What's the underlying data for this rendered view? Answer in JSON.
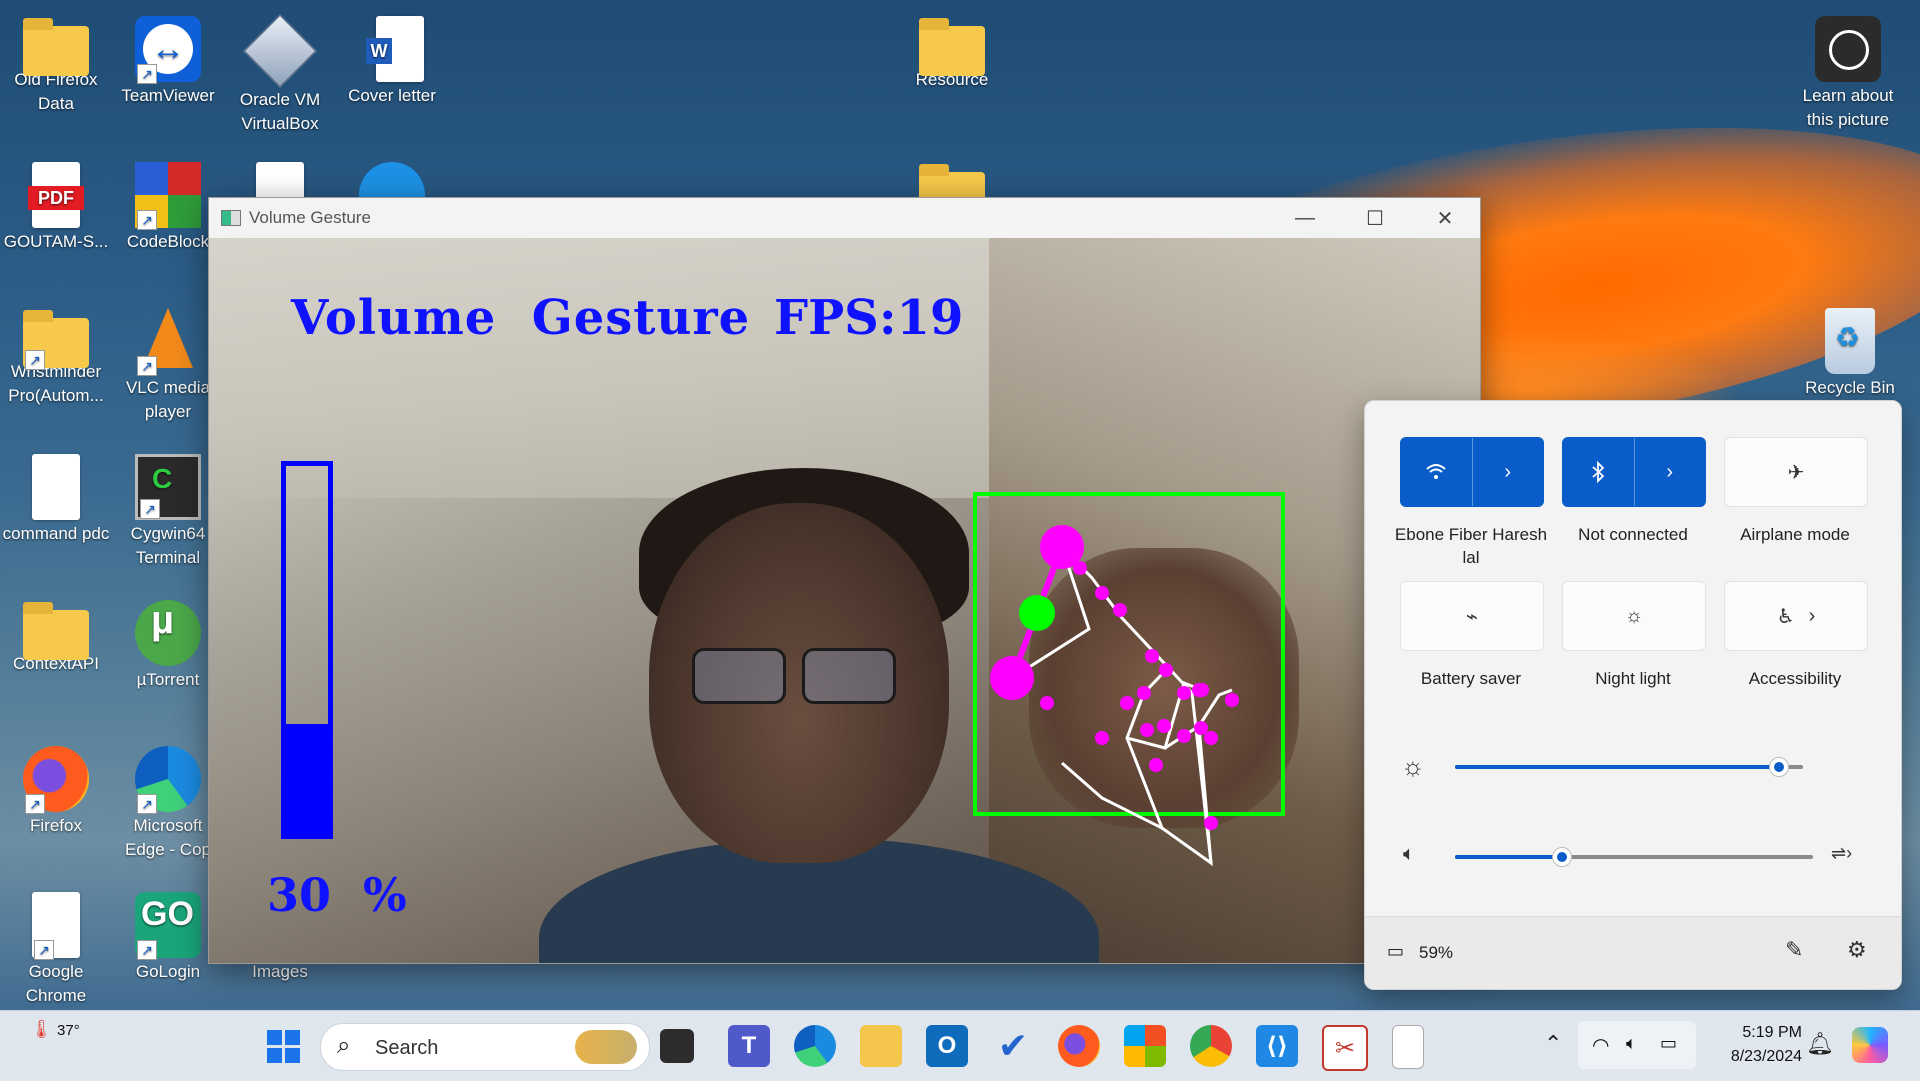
{
  "desktop": {
    "icons": [
      {
        "label": "Old Firefox Data"
      },
      {
        "label": "TeamViewer"
      },
      {
        "label": "Oracle VM VirtualBox"
      },
      {
        "label": "Cover letter"
      },
      {
        "label": "Resource"
      },
      {
        "label": "Learn about this picture"
      },
      {
        "label": "GOUTAM-S..."
      },
      {
        "label": "CodeBlock"
      },
      {
        "label": "Wristminder Pro(Autom..."
      },
      {
        "label": "VLC media player"
      },
      {
        "label": "Recycle Bin"
      },
      {
        "label": "command pdc"
      },
      {
        "label": "Cygwin64 Terminal"
      },
      {
        "label": "ContextAPI"
      },
      {
        "label": "µTorrent"
      },
      {
        "label": "Firefox"
      },
      {
        "label": "Microsoft Edge - Cop"
      },
      {
        "label": "Google Chrome"
      },
      {
        "label": "GoLogin"
      },
      {
        "label": "Images"
      }
    ]
  },
  "window": {
    "title": "Volume Gesture",
    "overlay": {
      "heading": "Volume  Gesture",
      "fps": "FPS:19",
      "volume_percent_text": "30  %",
      "volume_level": 0.3,
      "bar_color": "#0000ff",
      "hand_box_color": "#00ff00",
      "landmark_color": "#ff00ff",
      "midpoint_color": "#00ff00"
    }
  },
  "quick_settings": {
    "tiles": [
      {
        "label": "Ebone Fiber Haresh lal",
        "icon": "wifi-icon",
        "active": true
      },
      {
        "label": "Not connected",
        "icon": "bluetooth-icon",
        "active": true
      },
      {
        "label": "Airplane mode",
        "icon": "airplane-icon",
        "active": false
      },
      {
        "label": "Battery saver",
        "icon": "battery-saver-icon",
        "active": false
      },
      {
        "label": "Night light",
        "icon": "night-light-icon",
        "active": false
      },
      {
        "label": "Accessibility",
        "icon": "accessibility-icon",
        "active": false
      }
    ],
    "brightness": 0.93,
    "volume": 0.3,
    "battery": "59%",
    "accent": "#0a5cc8"
  },
  "taskbar": {
    "weather_temp": "37°",
    "search_placeholder": "Search",
    "time": "5:19 PM",
    "date": "8/23/2024"
  }
}
